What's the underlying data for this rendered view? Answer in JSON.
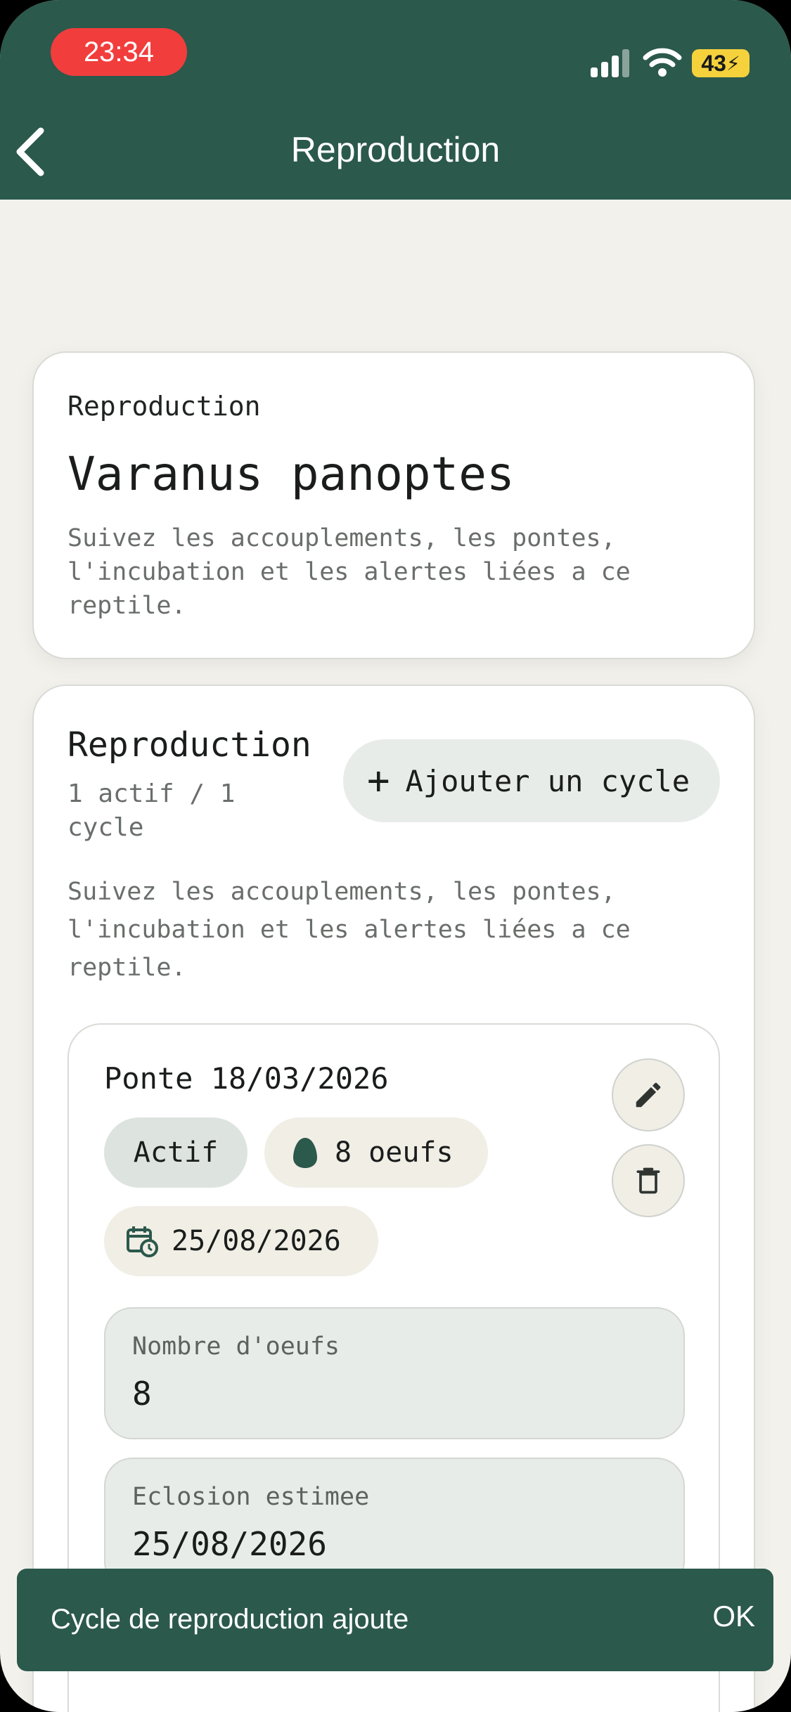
{
  "status_bar": {
    "time": "23:34",
    "battery": "43"
  },
  "header": {
    "title": "Reproduction"
  },
  "summary_card": {
    "overline": "Reproduction",
    "species": "Varanus panoptes",
    "description": "Suivez les accouplements, les pontes,\nl'incubation et les alertes liées a ce\nreptile."
  },
  "repro_section": {
    "title": "Reproduction",
    "count": "1 actif / 1 cycle",
    "add_button": "Ajouter un cycle",
    "description": "Suivez les accouplements, les pontes,\nl'incubation et les alertes liées a ce\nreptile."
  },
  "cycle": {
    "title": "Ponte 18/03/2026",
    "status_chip": "Actif",
    "eggs_chip": "8 oeufs",
    "date_chip": "25/08/2026",
    "fields": [
      {
        "label": "Nombre d'oeufs",
        "value": "8"
      },
      {
        "label": "Eclosion estimee",
        "value": "25/08/2026"
      }
    ]
  },
  "snackbar": {
    "message": "Cycle de reproduction ajoute",
    "action": "OK"
  },
  "colors": {
    "primary": "#2b594c",
    "background": "#f3f1ec",
    "status_pill": "#f23d3d",
    "battery": "#f5d23c"
  }
}
